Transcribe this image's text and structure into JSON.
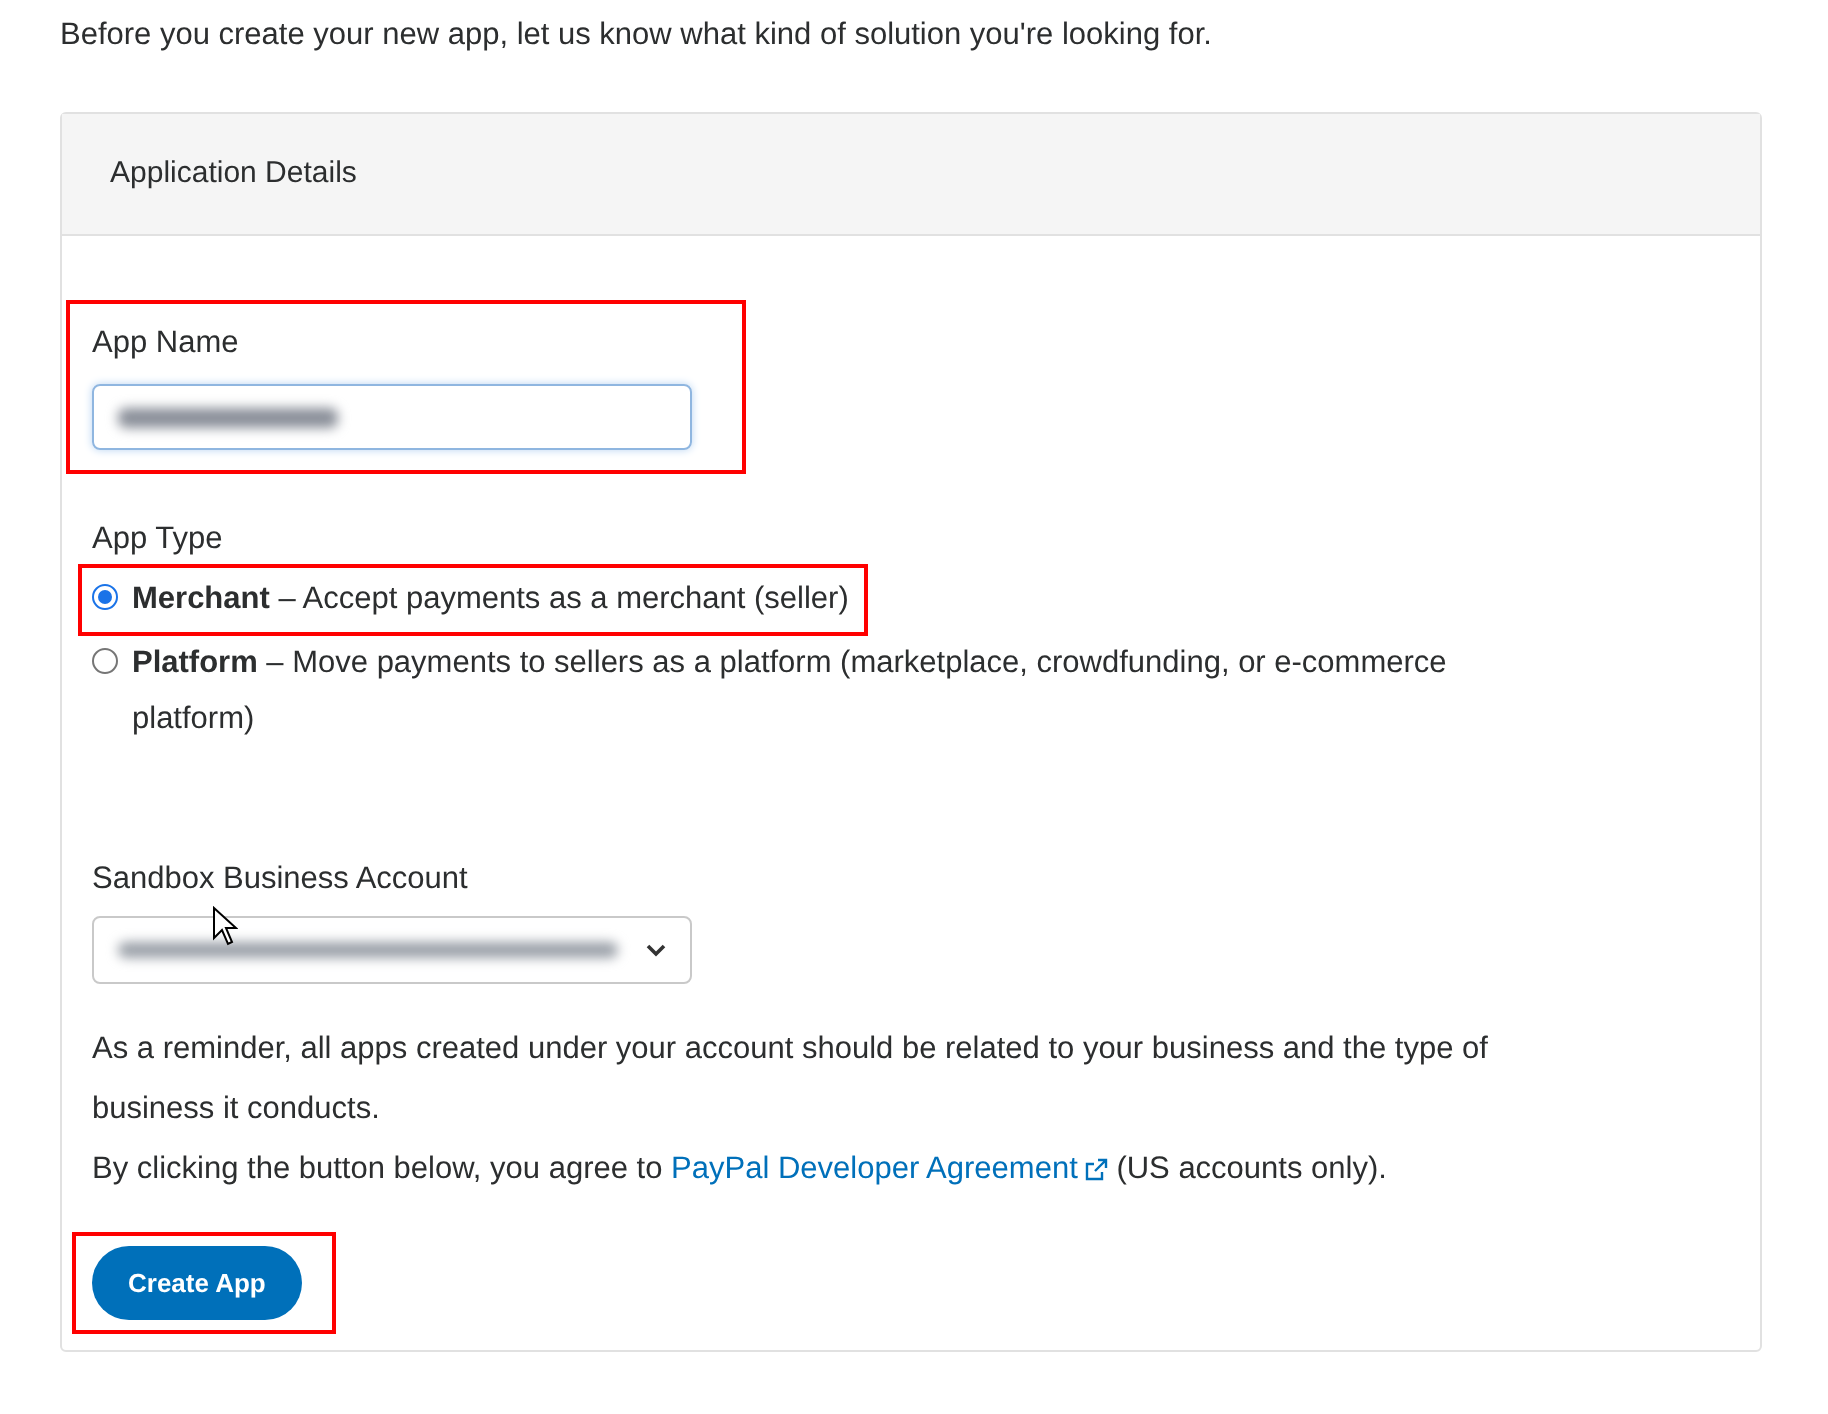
{
  "intro": "Before you create your new app, let us know what kind of solution you're looking for.",
  "card": {
    "title": "Application Details"
  },
  "app_name": {
    "label": "App Name",
    "highlighted": true
  },
  "app_type": {
    "label": "App Type",
    "options": [
      {
        "text": "**Merchant** – Accept payments as a merchant (seller)",
        "selected": true,
        "highlighted": true
      },
      {
        "text": "**Platform** – Move payments to sellers as a platform (marketplace, crowdfunding, or e-commerce platform)",
        "selected": false,
        "highlighted": false
      }
    ]
  },
  "sandbox_account": {
    "label": "Sandbox Business Account"
  },
  "reminder": "As a reminder, all apps created under your account should be related to your business and the type of business it conducts.",
  "agreement": {
    "before": "By clicking the button below, you agree to",
    "link": "PayPal Developer Agreement",
    "after": "(US accounts only)."
  },
  "button": {
    "label": "Create App",
    "highlighted": true
  }
}
